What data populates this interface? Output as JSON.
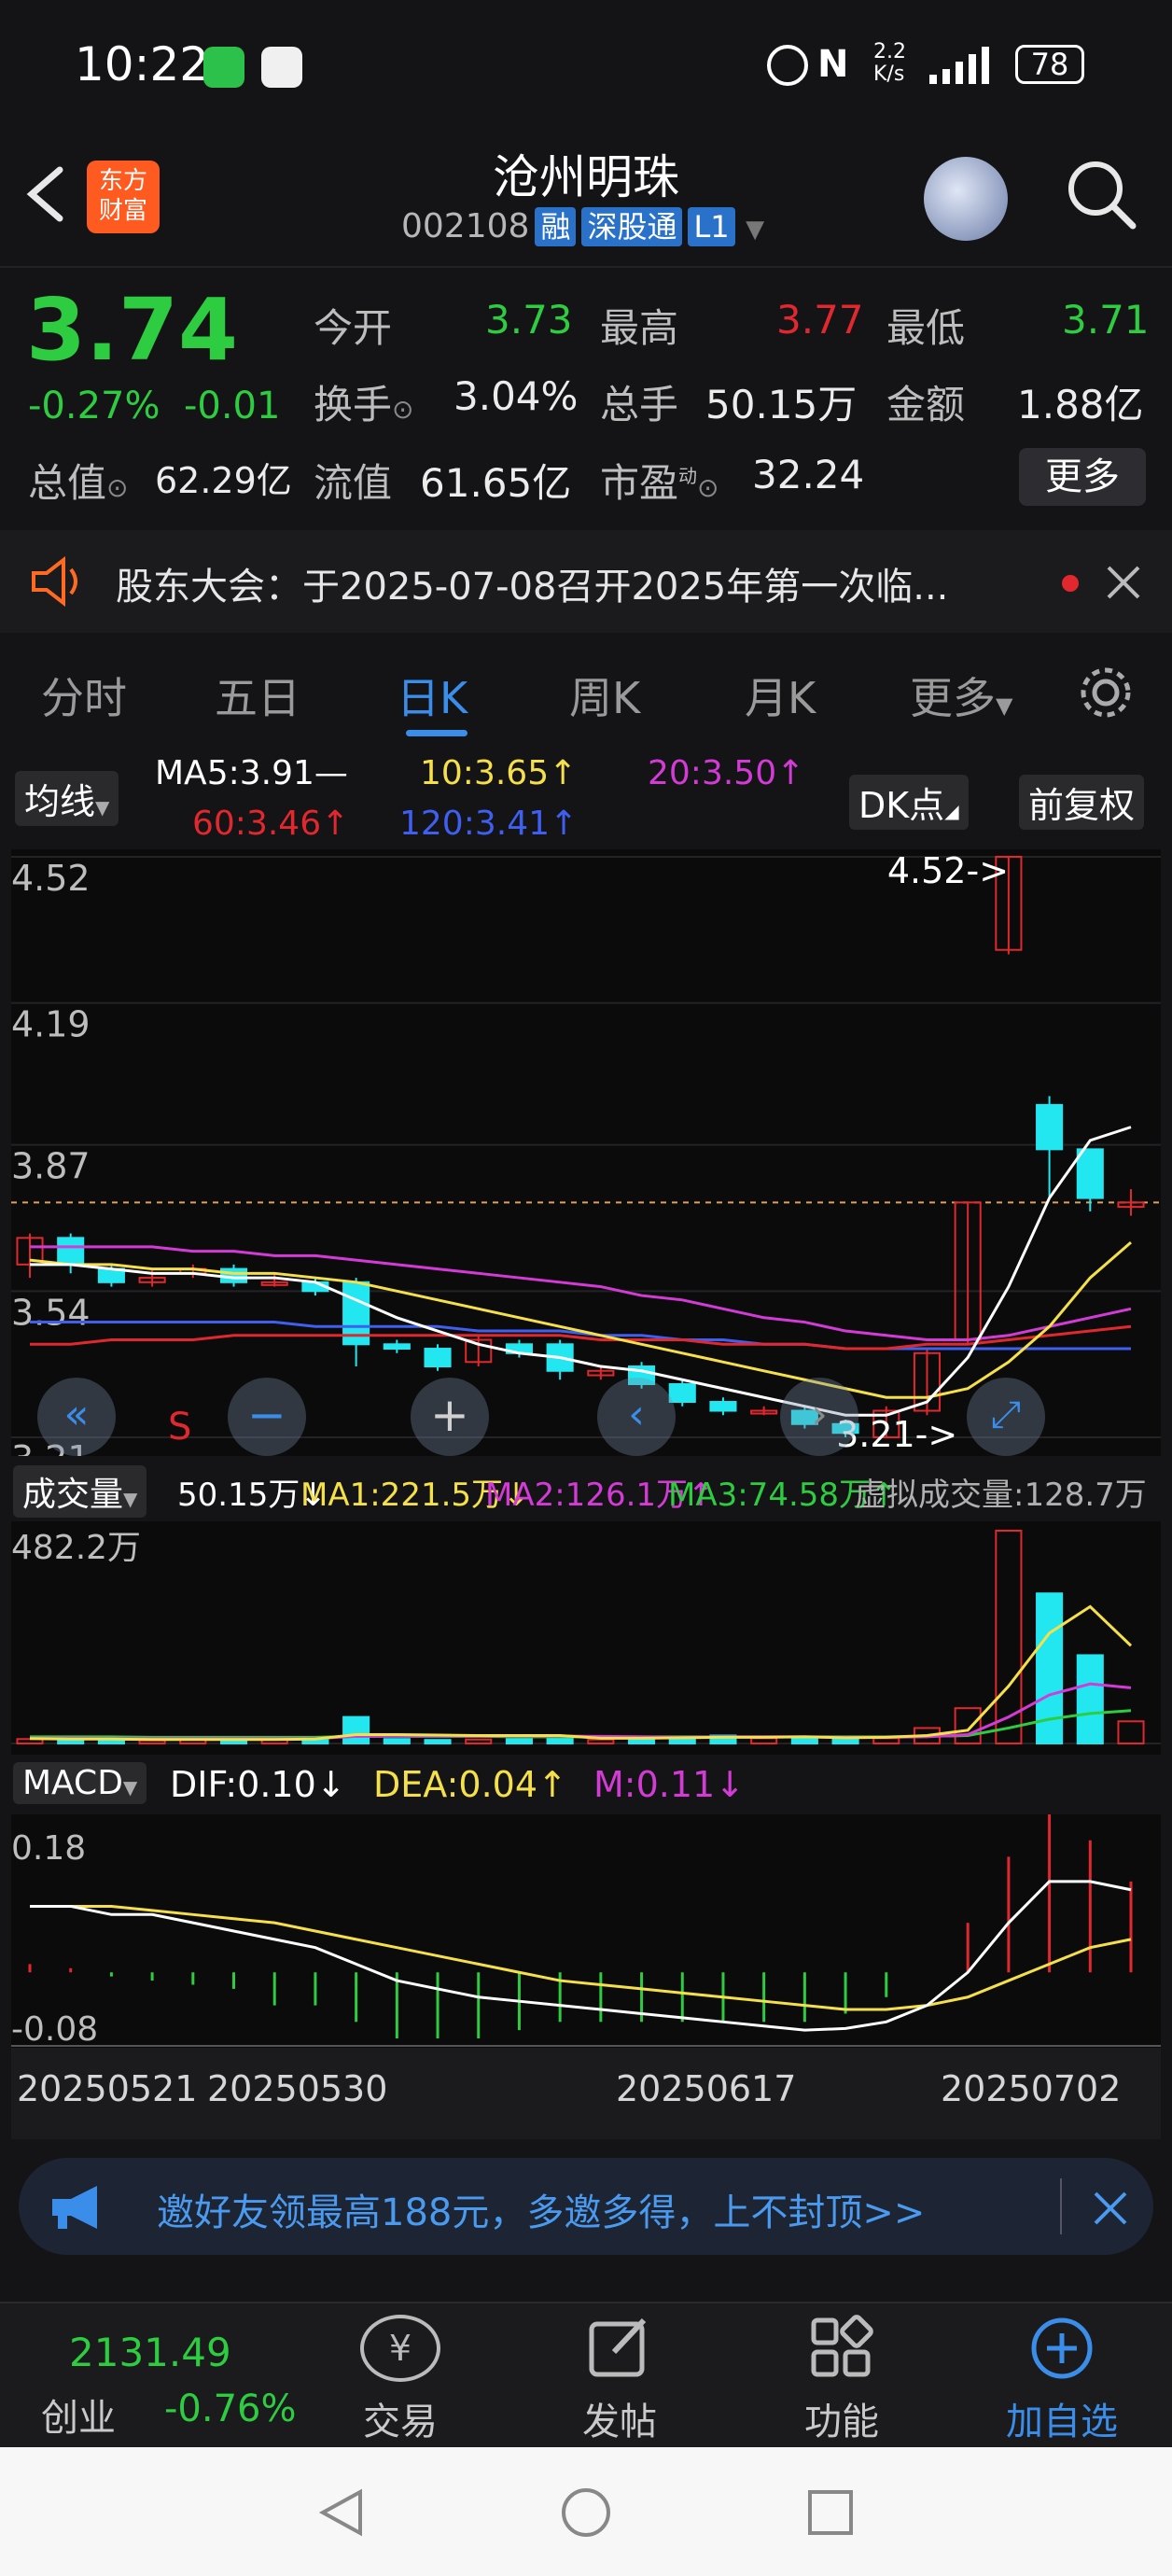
{
  "status_bar": {
    "time": "10:22",
    "net_speed_top": "2.2",
    "net_speed_bottom": "K/s",
    "battery": "78"
  },
  "header": {
    "logo_line1": "东方",
    "logo_line2": "财富",
    "stock_name": "沧州明珠",
    "stock_code": "002108",
    "tags": [
      "融",
      "深股通",
      "L1"
    ]
  },
  "quote": {
    "price": "3.74",
    "change_pct": "-0.27%",
    "change_abs": "-0.01",
    "open_label": "今开",
    "open": "3.73",
    "high_label": "最高",
    "high": "3.77",
    "low_label": "最低",
    "low": "3.71",
    "turnover_label": "换手",
    "turnover": "3.04%",
    "volume_label": "总手",
    "volume": "50.15万",
    "amount_label": "金额",
    "amount": "1.88亿",
    "mktcap_label": "总值",
    "mktcap": "62.29亿",
    "float_label": "流值",
    "float": "61.65亿",
    "pe_label": "市盈",
    "pe_sup": "动",
    "pe": "32.24",
    "more_label": "更多"
  },
  "notice": {
    "text": "股东大会：于2025-07-08召开2025年第一次临..."
  },
  "tabs": [
    "分时",
    "五日",
    "日K",
    "周K",
    "月K",
    "更多"
  ],
  "active_tab": "日K",
  "ma_bar": {
    "selector": "均线",
    "ma5": "MA5:3.91",
    "ma5_suffix": "—",
    "ma10": "10:3.65",
    "ma20": "20:3.50",
    "ma60": "60:3.46",
    "ma120": "120:3.41",
    "arrow_up": "↑",
    "dk_label": "DK点",
    "adjust_label": "前复权",
    "colors": {
      "ma5": "#ffffff",
      "ma10": "#f5e04a",
      "ma20": "#d43bd6",
      "ma60": "#e0282e",
      "ma120": "#3f5ff0"
    }
  },
  "kline": {
    "price_ticks": [
      "4.52",
      "4.19",
      "3.87",
      "3.54",
      "3.21"
    ],
    "high_marker": "4.52->",
    "low_marker": "3.21->",
    "sell_marker": "S"
  },
  "volume_bar": {
    "selector": "成交量",
    "current": "50.15万↓",
    "ma1": "MA1:221.5万↓",
    "ma2": "MA2:126.1万↑",
    "ma3": "MA3:74.58万↑",
    "virtual": "虚拟成交量:128.7万",
    "top_tick": "482.2万"
  },
  "macd_bar": {
    "selector": "MACD",
    "dif": "DIF:0.10↓",
    "dea": "DEA:0.04↑",
    "m": "M:0.11↓",
    "top_tick": "0.18",
    "bottom_tick": "-0.08"
  },
  "dates": [
    "20250521",
    "20250530",
    "20250617",
    "20250702"
  ],
  "banner": {
    "text": "邀好友领最高188元，多邀多得，上不封顶>>"
  },
  "bottom_nav": {
    "index_value": "2131.49",
    "index_name": "创业",
    "index_change": "-0.76%",
    "items": [
      "交易",
      "发帖",
      "功能",
      "加自选"
    ]
  },
  "chart_data": {
    "type": "candlestick",
    "title": "沧州明珠 日K",
    "xlabel": "",
    "ylabel": "",
    "ylim": [
      3.21,
      4.52
    ],
    "grid": true,
    "candles": [
      {
        "o": 3.6,
        "c": 3.66,
        "h": 3.67,
        "l": 3.57
      },
      {
        "o": 3.66,
        "c": 3.6,
        "h": 3.67,
        "l": 3.58
      },
      {
        "o": 3.59,
        "c": 3.56,
        "h": 3.6,
        "l": 3.55
      },
      {
        "o": 3.56,
        "c": 3.57,
        "h": 3.59,
        "l": 3.55
      },
      {
        "o": 3.58,
        "c": 3.59,
        "h": 3.6,
        "l": 3.57
      },
      {
        "o": 3.59,
        "c": 3.56,
        "h": 3.6,
        "l": 3.55
      },
      {
        "o": 3.56,
        "c": 3.56,
        "h": 3.58,
        "l": 3.55
      },
      {
        "o": 3.56,
        "c": 3.54,
        "h": 3.57,
        "l": 3.53
      },
      {
        "o": 3.56,
        "c": 3.42,
        "h": 3.57,
        "l": 3.37
      },
      {
        "o": 3.42,
        "c": 3.41,
        "h": 3.43,
        "l": 3.4
      },
      {
        "o": 3.41,
        "c": 3.37,
        "h": 3.42,
        "l": 3.36
      },
      {
        "o": 3.38,
        "c": 3.43,
        "h": 3.44,
        "l": 3.37
      },
      {
        "o": 3.42,
        "c": 3.4,
        "h": 3.43,
        "l": 3.39
      },
      {
        "o": 3.42,
        "c": 3.36,
        "h": 3.43,
        "l": 3.34
      },
      {
        "o": 3.35,
        "c": 3.36,
        "h": 3.37,
        "l": 3.34
      },
      {
        "o": 3.37,
        "c": 3.33,
        "h": 3.38,
        "l": 3.32
      },
      {
        "o": 3.33,
        "c": 3.29,
        "h": 3.34,
        "l": 3.28
      },
      {
        "o": 3.29,
        "c": 3.27,
        "h": 3.3,
        "l": 3.26
      },
      {
        "o": 3.27,
        "c": 3.27,
        "h": 3.28,
        "l": 3.26
      },
      {
        "o": 3.27,
        "c": 3.24,
        "h": 3.28,
        "l": 3.23
      },
      {
        "o": 3.24,
        "c": 3.22,
        "h": 3.25,
        "l": 3.21
      },
      {
        "o": 3.21,
        "c": 3.27,
        "h": 3.28,
        "l": 3.21
      },
      {
        "o": 3.27,
        "c": 3.4,
        "h": 3.41,
        "l": 3.26
      },
      {
        "o": 3.43,
        "c": 3.74,
        "h": 3.74,
        "l": 3.42
      },
      {
        "o": 4.31,
        "c": 4.73,
        "h": 4.75,
        "l": 4.3
      },
      {
        "o": 3.96,
        "c": 3.86,
        "h": 3.98,
        "l": 3.75
      },
      {
        "o": 3.86,
        "c": 3.75,
        "h": 3.86,
        "l": 3.72
      },
      {
        "o": 3.73,
        "c": 3.74,
        "h": 3.77,
        "l": 3.71
      }
    ],
    "ma5": [
      3.6,
      3.6,
      3.59,
      3.58,
      3.58,
      3.57,
      3.57,
      3.56,
      3.52,
      3.48,
      3.45,
      3.42,
      3.4,
      3.39,
      3.37,
      3.36,
      3.34,
      3.32,
      3.3,
      3.28,
      3.26,
      3.26,
      3.29,
      3.39,
      3.55,
      3.75,
      3.88,
      3.91
    ],
    "ma10": [
      3.61,
      3.6,
      3.6,
      3.59,
      3.59,
      3.58,
      3.58,
      3.57,
      3.56,
      3.54,
      3.52,
      3.5,
      3.48,
      3.46,
      3.44,
      3.42,
      3.4,
      3.38,
      3.36,
      3.34,
      3.32,
      3.3,
      3.3,
      3.32,
      3.38,
      3.46,
      3.57,
      3.65
    ],
    "ma20": [
      3.64,
      3.64,
      3.64,
      3.64,
      3.63,
      3.63,
      3.62,
      3.62,
      3.61,
      3.6,
      3.59,
      3.58,
      3.57,
      3.56,
      3.55,
      3.53,
      3.52,
      3.5,
      3.48,
      3.47,
      3.45,
      3.44,
      3.43,
      3.43,
      3.44,
      3.46,
      3.48,
      3.5
    ],
    "ma60": [
      3.42,
      3.42,
      3.43,
      3.43,
      3.43,
      3.44,
      3.44,
      3.44,
      3.44,
      3.44,
      3.44,
      3.44,
      3.44,
      3.44,
      3.43,
      3.43,
      3.43,
      3.42,
      3.42,
      3.42,
      3.41,
      3.41,
      3.42,
      3.42,
      3.43,
      3.44,
      3.45,
      3.46
    ],
    "ma120": [
      3.47,
      3.47,
      3.47,
      3.47,
      3.47,
      3.47,
      3.47,
      3.46,
      3.46,
      3.46,
      3.46,
      3.45,
      3.45,
      3.45,
      3.44,
      3.44,
      3.43,
      3.43,
      3.42,
      3.42,
      3.41,
      3.41,
      3.41,
      3.41,
      3.41,
      3.41,
      3.41,
      3.41
    ],
    "volume": {
      "ylim": [
        0,
        482.2
      ],
      "values": [
        10,
        8,
        9,
        7,
        9,
        8,
        10,
        12,
        60,
        10,
        8,
        9,
        10,
        12,
        9,
        15,
        13,
        18,
        12,
        14,
        9,
        12,
        35,
        80,
        482.2,
        340,
        200,
        50.15
      ],
      "ma1": [
        11,
        10,
        10,
        9,
        9,
        9,
        9,
        10,
        20,
        20,
        19,
        18,
        18,
        18,
        12,
        12,
        13,
        14,
        14,
        15,
        13,
        14,
        18,
        30,
        130,
        250,
        310,
        221.5
      ],
      "ma2": [
        12,
        12,
        11,
        11,
        11,
        11,
        11,
        11,
        16,
        17,
        17,
        17,
        17,
        17,
        16,
        15,
        14,
        15,
        15,
        15,
        14,
        14,
        15,
        20,
        60,
        110,
        135,
        126.1
      ],
      "ma3": [
        15,
        15,
        15,
        14,
        14,
        14,
        14,
        14,
        16,
        16,
        16,
        16,
        15,
        15,
        15,
        15,
        15,
        15,
        15,
        15,
        15,
        15,
        16,
        18,
        35,
        55,
        68,
        74.58
      ]
    },
    "macd": {
      "ylim": [
        -0.08,
        0.18
      ],
      "dif": [
        0.08,
        0.08,
        0.07,
        0.07,
        0.06,
        0.05,
        0.04,
        0.03,
        0.01,
        -0.01,
        -0.02,
        -0.03,
        -0.035,
        -0.04,
        -0.045,
        -0.05,
        -0.055,
        -0.06,
        -0.065,
        -0.07,
        -0.068,
        -0.06,
        -0.04,
        0.0,
        0.06,
        0.11,
        0.11,
        0.1
      ],
      "dea": [
        0.08,
        0.08,
        0.08,
        0.075,
        0.07,
        0.065,
        0.06,
        0.05,
        0.04,
        0.03,
        0.02,
        0.01,
        0.0,
        -0.01,
        -0.015,
        -0.02,
        -0.025,
        -0.03,
        -0.035,
        -0.04,
        -0.045,
        -0.045,
        -0.04,
        -0.03,
        -0.01,
        0.01,
        0.03,
        0.04
      ],
      "m": [
        0.01,
        0.005,
        -0.005,
        -0.01,
        -0.015,
        -0.02,
        -0.04,
        -0.04,
        -0.06,
        -0.08,
        -0.08,
        -0.08,
        -0.07,
        -0.06,
        -0.06,
        -0.06,
        -0.06,
        -0.06,
        -0.06,
        -0.06,
        -0.05,
        -0.03,
        0.0,
        0.06,
        0.14,
        0.2,
        0.16,
        0.11
      ]
    }
  }
}
